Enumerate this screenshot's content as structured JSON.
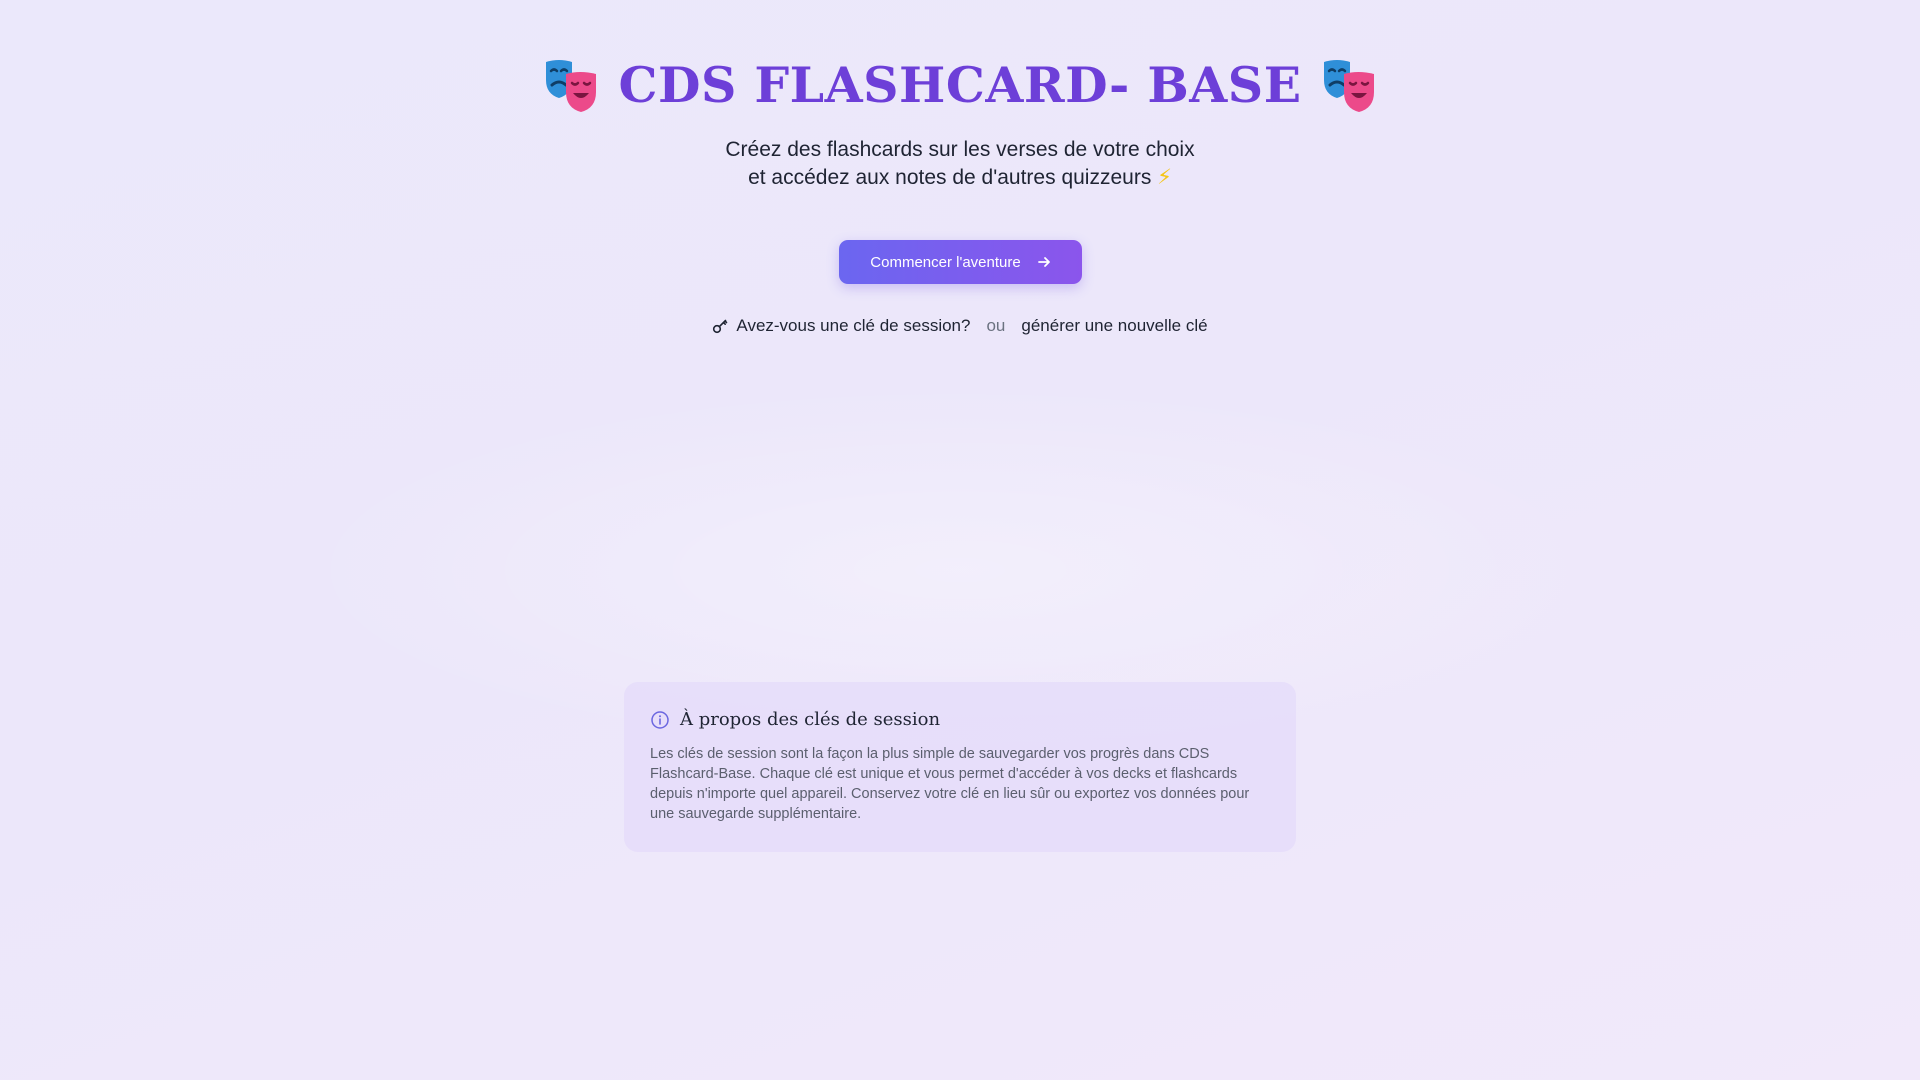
{
  "hero": {
    "mask_icon": "performing-arts-masks-icon",
    "title": "CDS FLASHCARD- BASE",
    "subtitle_line1": "Créez des flashcards sur les verses de votre choix",
    "subtitle_line2": "et accédez aux notes de d'autres quizzeurs",
    "subtitle_emoji": "⚡"
  },
  "cta": {
    "label": "Commencer l'aventure",
    "icon": "arrow-right-icon"
  },
  "session": {
    "key_icon": "key-icon",
    "have_key_label": "Avez-vous une clé de session?",
    "or_label": "ou",
    "generate_label": "générer une nouvelle clé"
  },
  "info": {
    "icon": "info-circle-icon",
    "title": "À propos des clés de session",
    "text": "Les clés de session sont la façon la plus simple de sauvegarder vos progrès dans CDS Flashcard-Base. Chaque clé est unique et vous permet d'accéder à vos decks et flashcards depuis n'importe quel appareil. Conservez votre clé en lieu sûr ou exportez vos données pour une sauvegarde supplémentaire."
  },
  "colors": {
    "accent": "#6d3fd8",
    "button_start": "#6b66f0",
    "button_end": "#8b55ec",
    "background": "#ebe8fb"
  }
}
